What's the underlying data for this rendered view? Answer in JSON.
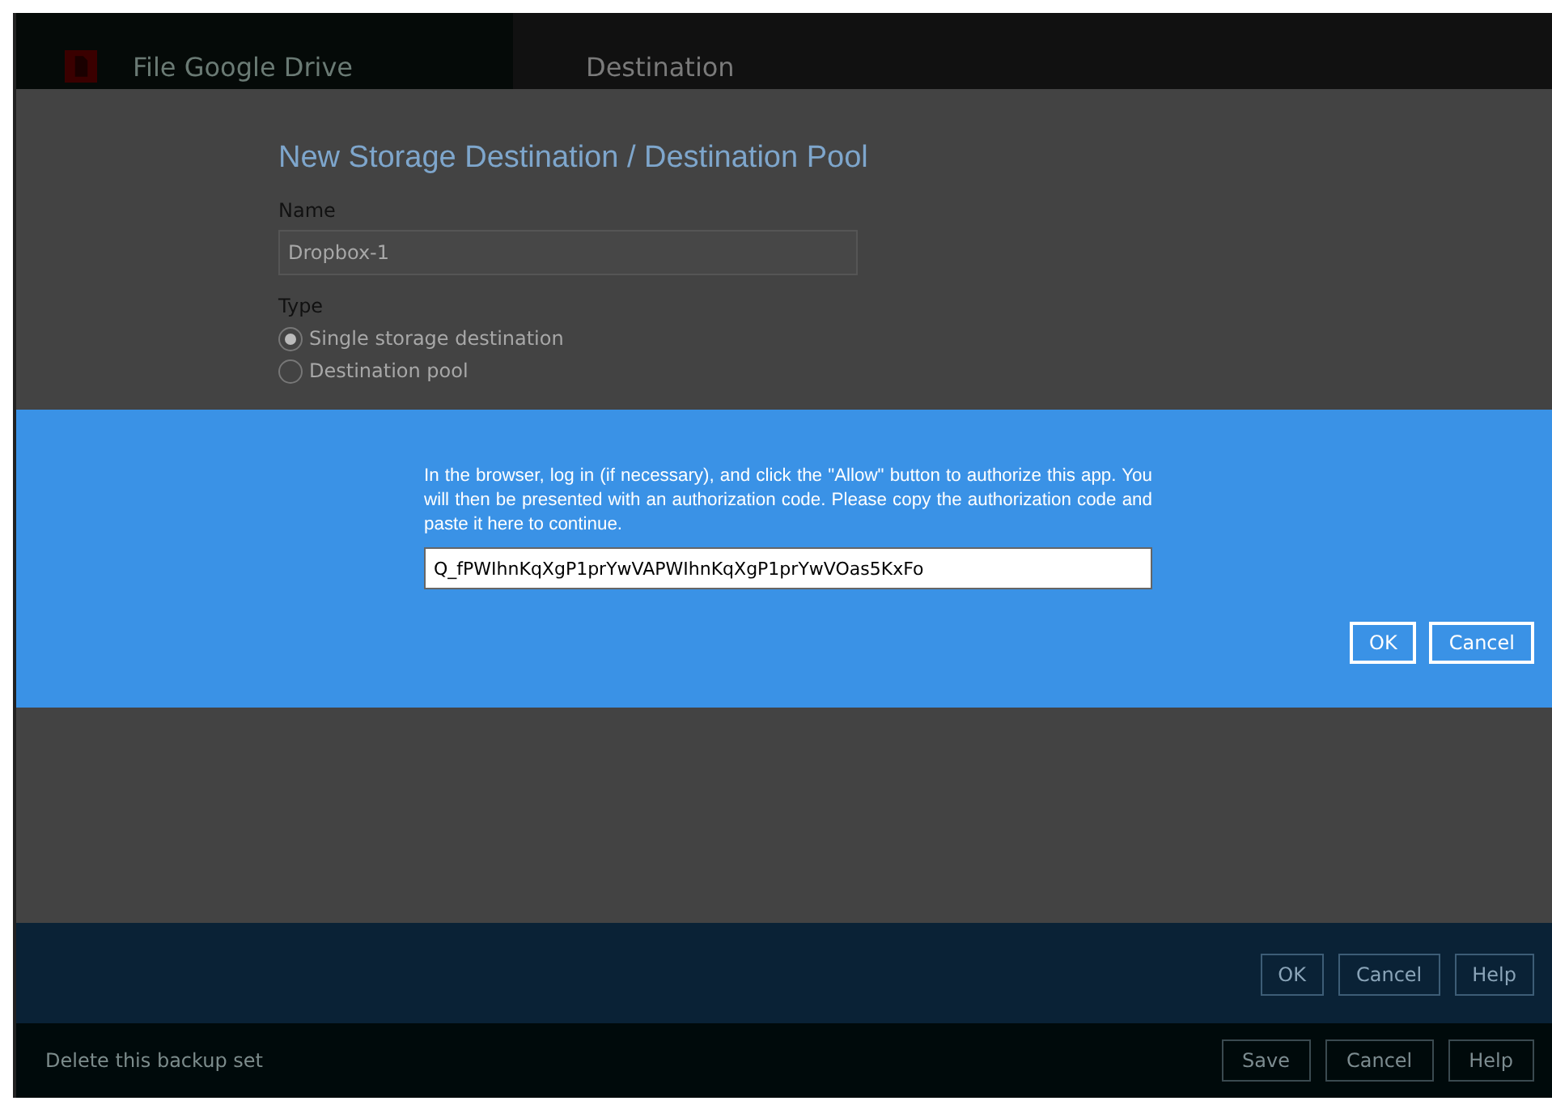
{
  "header": {
    "app_title": "File Google Drive",
    "section_title": "Destination"
  },
  "form": {
    "title": "New Storage Destination / Destination Pool",
    "name_label": "Name",
    "name_value": "Dropbox-1",
    "type_label": "Type",
    "type_options": [
      {
        "label": "Single storage destination",
        "selected": true
      },
      {
        "label": "Destination pool",
        "selected": false
      }
    ]
  },
  "dialog": {
    "message": "In the browser, log in (if necessary), and click the \"Allow\" button to authorize this app. You will then be presented with an authorization code. Please copy the authorization code and paste it here to continue.",
    "code_value": "Q_fPWIhnKqXgP1prYwVAPWIhnKqXgP1prYwVOas5KxFo",
    "buttons": [
      "OK",
      "Cancel"
    ]
  },
  "form_buttons": [
    "OK",
    "Cancel",
    "Help"
  ],
  "footer": {
    "delete_link": "Delete this backup set",
    "buttons": [
      "Save",
      "Cancel",
      "Help"
    ]
  }
}
